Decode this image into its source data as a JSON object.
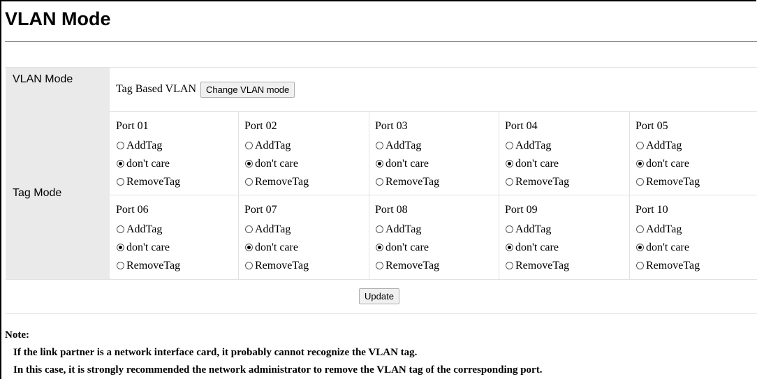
{
  "page": {
    "title": "VLAN Mode"
  },
  "vlan_mode": {
    "label": "VLAN Mode",
    "current_mode": "Tag Based VLAN",
    "change_button": "Change VLAN mode"
  },
  "tag_mode": {
    "label": "Tag Mode",
    "ports": [
      {
        "name": "Port 01",
        "options": [
          "AddTag",
          "don't care",
          "RemoveTag"
        ],
        "selected": "don't care"
      },
      {
        "name": "Port 02",
        "options": [
          "AddTag",
          "don't care",
          "RemoveTag"
        ],
        "selected": "don't care"
      },
      {
        "name": "Port 03",
        "options": [
          "AddTag",
          "don't care",
          "RemoveTag"
        ],
        "selected": "don't care"
      },
      {
        "name": "Port 04",
        "options": [
          "AddTag",
          "don't care",
          "RemoveTag"
        ],
        "selected": "don't care"
      },
      {
        "name": "Port 05",
        "options": [
          "AddTag",
          "don't care",
          "RemoveTag"
        ],
        "selected": "don't care"
      },
      {
        "name": "Port 06",
        "options": [
          "AddTag",
          "don't care",
          "RemoveTag"
        ],
        "selected": "don't care"
      },
      {
        "name": "Port 07",
        "options": [
          "AddTag",
          "don't care",
          "RemoveTag"
        ],
        "selected": "don't care"
      },
      {
        "name": "Port 08",
        "options": [
          "AddTag",
          "don't care",
          "RemoveTag"
        ],
        "selected": "don't care"
      },
      {
        "name": "Port 09",
        "options": [
          "AddTag",
          "don't care",
          "RemoveTag"
        ],
        "selected": "don't care"
      },
      {
        "name": "Port 10",
        "options": [
          "AddTag",
          "don't care",
          "RemoveTag"
        ],
        "selected": "don't care"
      }
    ]
  },
  "update_button": "Update",
  "note": {
    "heading": "Note:",
    "lines": [
      "If the link partner is a network interface card, it probably cannot recognize the VLAN tag.",
      "In this case, it is strongly recommended the network administrator to remove the VLAN tag of the corresponding port."
    ]
  }
}
